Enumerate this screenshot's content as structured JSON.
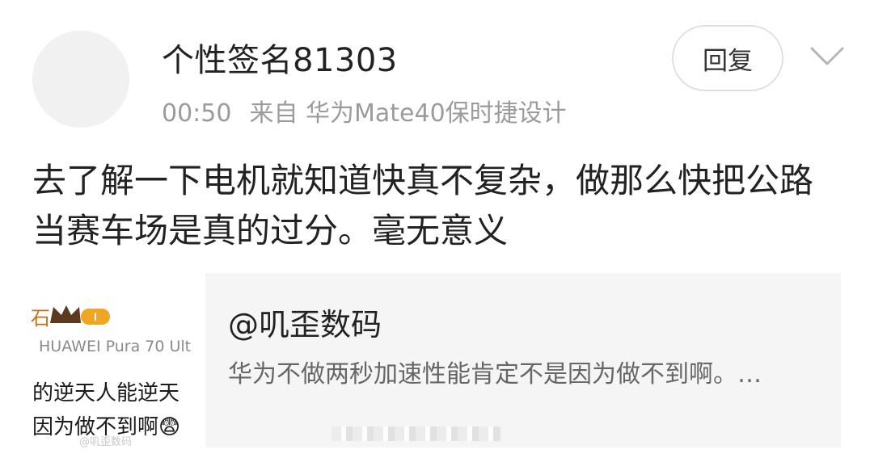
{
  "post": {
    "username": "个性签名81303",
    "time": "00:50",
    "source": "来自 华为Mate40保时捷设计",
    "reply_label": "回复",
    "body": "去了解一下电机就知道快真不复杂，做那么快把公路当赛车场是真的过分。毫无意义"
  },
  "quote": {
    "author": "@叽歪数码",
    "text": "华为不做两秒加速性能肯定不是因为做不到啊。…",
    "thumbnail": {
      "badge_text": "石",
      "device": "HUAWEI Pura 70 Ult",
      "line1": "的逆天人能逆天",
      "line2": "因为做不到啊😨",
      "watermark": "@叽歪数码"
    }
  },
  "icons": {
    "avatar": "default-avatar-icon",
    "chevron": "chevron-down-icon",
    "crown": "crown-badge-icon"
  },
  "colors": {
    "text_primary": "#222222",
    "text_secondary": "#9b9b9b",
    "quote_background": "#f5f5f5"
  }
}
